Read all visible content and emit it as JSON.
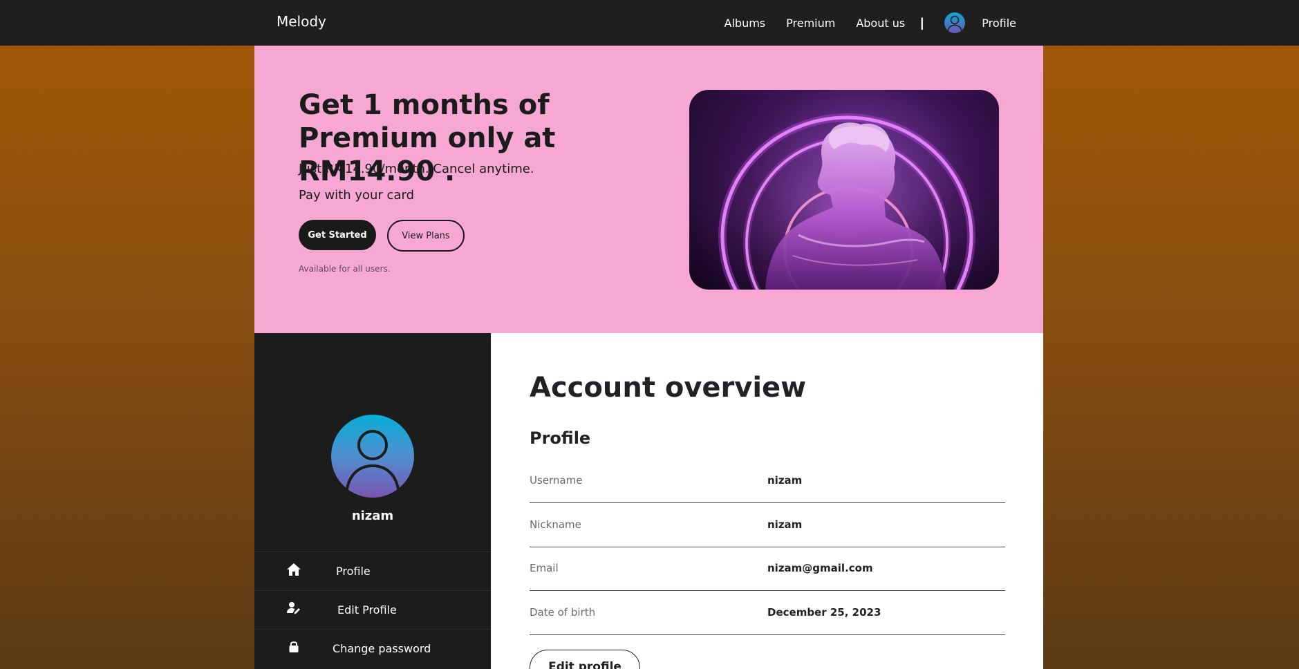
{
  "navbar": {
    "brand": "Melody",
    "links": [
      "Albums",
      "Premium",
      "About us"
    ],
    "separator": "|",
    "profile_label": "Profile",
    "avatar_icon": "user-avatar-icon"
  },
  "hero": {
    "title": "Get 1 months of Premium only at RM14.90 .",
    "subtitle": "Just RM14.90/month. Cancel anytime.",
    "payment_note": "Pay with your card",
    "primary_button": "Get Started",
    "secondary_button": "View Plans",
    "availability_note": "Available for all users.",
    "background_color": "#f6a8d2"
  },
  "sidebar": {
    "username": "nizam",
    "avatar_icon": "user-avatar-icon",
    "items": [
      {
        "label": "Profile",
        "icon": "home-icon"
      },
      {
        "label": "Edit Profile",
        "icon": "user-edit-icon"
      },
      {
        "label": "Change password",
        "icon": "lock-icon"
      }
    ]
  },
  "main": {
    "title": "Account overview",
    "section_title": "Profile",
    "fields": [
      {
        "label": "Username",
        "value": "nizam"
      },
      {
        "label": "Nickname",
        "value": "nizam"
      },
      {
        "label": "Email",
        "value": "nizam@gmail.com"
      },
      {
        "label": "Date of birth",
        "value": "December 25, 2023"
      }
    ],
    "edit_button": "Edit profile"
  },
  "colors": {
    "navbar_bg": "#1f1f1f",
    "sidebar_bg": "#1c1c1c",
    "page_gradient_top": "#a55a06",
    "page_gradient_bottom": "#5b3a14"
  }
}
